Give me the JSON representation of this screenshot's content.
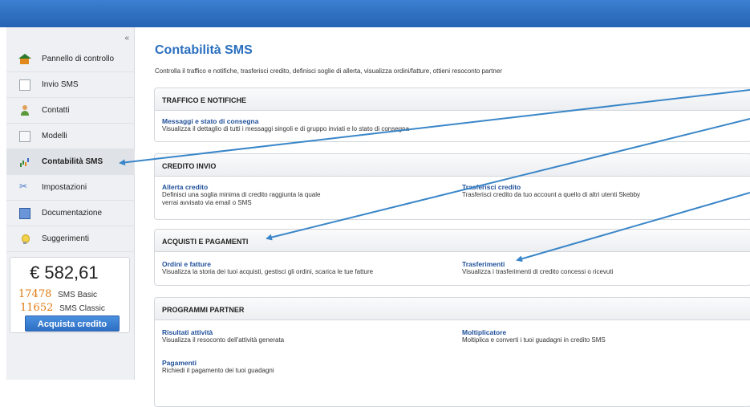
{
  "sidebar": {
    "collapse_label": "«",
    "items": [
      {
        "label": "Pannello di controllo",
        "icon": "home-icon"
      },
      {
        "label": "Invio SMS",
        "icon": "document-icon"
      },
      {
        "label": "Contatti",
        "icon": "user-icon"
      },
      {
        "label": "Modelli",
        "icon": "template-icon"
      },
      {
        "label": "Contabilità SMS",
        "icon": "chart-icon"
      },
      {
        "label": "Impostazioni",
        "icon": "tools-icon"
      },
      {
        "label": "Documentazione",
        "icon": "book-icon"
      },
      {
        "label": "Suggerimenti",
        "icon": "lightbulb-icon"
      }
    ],
    "active_item": "Contabilità SMS",
    "credit": {
      "amount": "€ 582,61",
      "sms_basic_count": "17478",
      "sms_basic_label": "SMS Basic",
      "sms_classic_count": "11652",
      "sms_classic_label": "SMS Classic",
      "buy_button": "Acquista credito"
    }
  },
  "main": {
    "title": "Contabilità SMS",
    "subtitle": "Controlla il traffico e notifiche, trasferisci credito, definisci soglie di allerta, visualizza ordini/fatture, ottieni resoconto partner",
    "sections": [
      {
        "header": "TRAFFICO E NOTIFICHE",
        "links": [
          {
            "title": "Messaggi e stato di consegna",
            "desc": "Visualizza il dettaglio di tutti i messaggi singoli e di gruppo inviati e lo stato di consegna"
          }
        ]
      },
      {
        "header": "CREDITO INVIO",
        "links": [
          {
            "title": "Allerta credito",
            "desc": "Definisci una soglia minima di credito raggiunta la quale verrai avvisato via email o SMS"
          },
          {
            "title": "Trasferisci credito",
            "desc": "Trasferisci credito da tuo account a quello di altri utenti Skebby"
          }
        ]
      },
      {
        "header": "ACQUISTI E PAGAMENTI",
        "links": [
          {
            "title": "Ordini e fatture",
            "desc": "Visualizza la storia dei tuoi acquisti, gestisci gli ordini, scarica le tue fatture"
          },
          {
            "title": "Trasferimenti",
            "desc": "Visualizza i trasferimenti di credito concessi o ricevuti"
          }
        ]
      },
      {
        "header": "PROGRAMMI PARTNER",
        "links": [
          {
            "title": "Risultati attività",
            "desc": "Visualizza il resoconto dell'attività generata"
          },
          {
            "title": "Moltiplicatore",
            "desc": "Moltiplica e converti i tuoi guadagni in credito SMS"
          },
          {
            "title": "Pagamenti",
            "desc": "Richiedi il pagamento dei tuoi guadagni"
          }
        ]
      }
    ]
  },
  "colors": {
    "topbar": "#2e6fc4",
    "title": "#2a6fbf",
    "link": "#1f4f9a",
    "credit_count": "#e07a10",
    "button": "#3a80d4",
    "annotation_arrow": "#3a86c8"
  }
}
